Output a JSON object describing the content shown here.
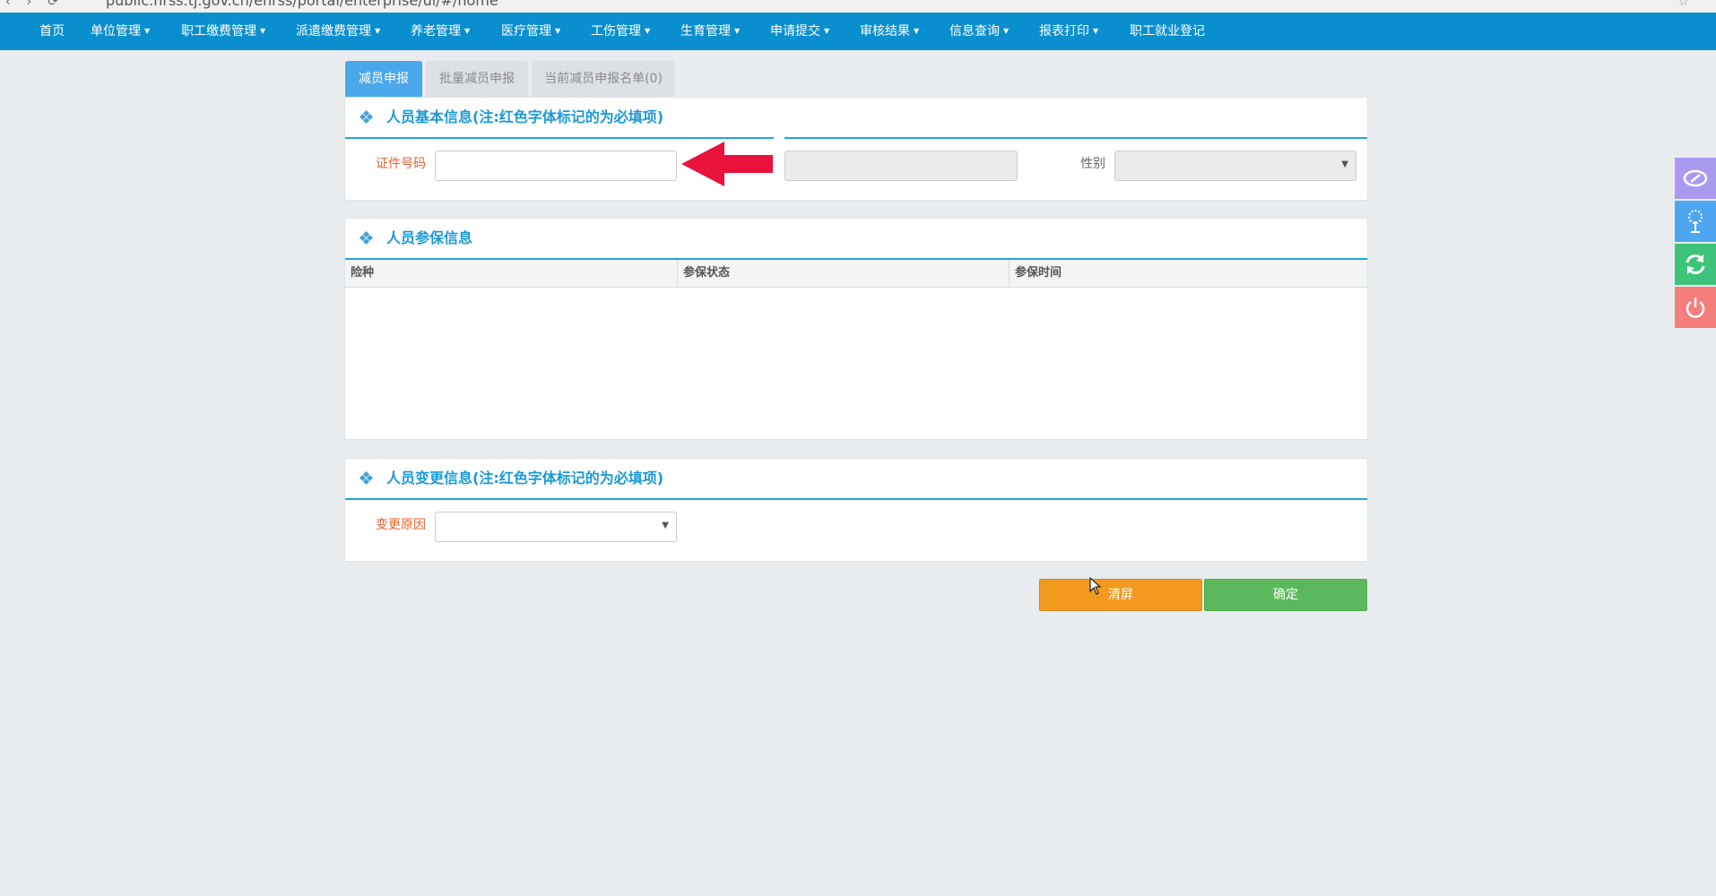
{
  "browser": {
    "url": "public.hrss.tj.gov.cn/ehrss/portal/enterprise/ui/#/home"
  },
  "nav": {
    "items": [
      {
        "label": "首页",
        "dropdown": false
      },
      {
        "label": "单位管理",
        "dropdown": true
      },
      {
        "label": "职工缴费管理",
        "dropdown": true
      },
      {
        "label": "派遣缴费管理",
        "dropdown": true
      },
      {
        "label": "养老管理",
        "dropdown": true
      },
      {
        "label": "医疗管理",
        "dropdown": true
      },
      {
        "label": "工伤管理",
        "dropdown": true
      },
      {
        "label": "生育管理",
        "dropdown": true
      },
      {
        "label": "申请提交",
        "dropdown": true
      },
      {
        "label": "审核结果",
        "dropdown": true
      },
      {
        "label": "信息查询",
        "dropdown": true
      },
      {
        "label": "报表打印",
        "dropdown": true
      },
      {
        "label": "职工就业登记",
        "dropdown": false
      }
    ]
  },
  "tabs": [
    {
      "label": "减员申报",
      "active": true
    },
    {
      "label": "批量减员申报",
      "active": false
    },
    {
      "label": "当前减员申报名单(0)",
      "active": false
    }
  ],
  "basic_info": {
    "title": "人员基本信息(注:红色字体标记的为必填项)",
    "id_label": "证件号码",
    "id_value": "",
    "name_value": "",
    "gender_label": "性别",
    "gender_value": ""
  },
  "insurance_info": {
    "title": "人员参保信息",
    "columns": [
      "险种",
      "参保状态",
      "参保时间"
    ],
    "rows": []
  },
  "change_info": {
    "title": "人员变更信息(注:红色字体标记的为必填项)",
    "reason_label": "变更原因",
    "reason_value": ""
  },
  "actions": {
    "clear_label": "清屏",
    "confirm_label": "确定"
  },
  "colors": {
    "nav_bg": "#0a8fce",
    "title": "#1a9ad6",
    "required_label": "#e9602c",
    "clear_button": "#f29a1e",
    "confirm_button": "#5cb85c",
    "annotation_arrow": "#e8123c"
  },
  "sidebar_icons": [
    "social-insurance-icon",
    "tree-icon",
    "refresh-icon",
    "power-icon"
  ]
}
